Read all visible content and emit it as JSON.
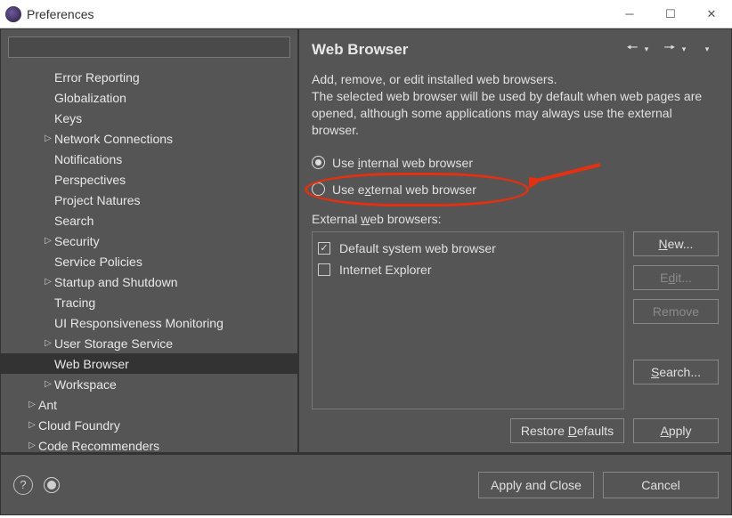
{
  "window": {
    "title": "Preferences"
  },
  "tree": [
    {
      "label": "Error Reporting",
      "level": 2,
      "expandable": false
    },
    {
      "label": "Globalization",
      "level": 2,
      "expandable": false
    },
    {
      "label": "Keys",
      "level": 2,
      "expandable": false
    },
    {
      "label": "Network Connections",
      "level": 2,
      "expandable": true
    },
    {
      "label": "Notifications",
      "level": 2,
      "expandable": false
    },
    {
      "label": "Perspectives",
      "level": 2,
      "expandable": false
    },
    {
      "label": "Project Natures",
      "level": 2,
      "expandable": false
    },
    {
      "label": "Search",
      "level": 2,
      "expandable": false
    },
    {
      "label": "Security",
      "level": 2,
      "expandable": true
    },
    {
      "label": "Service Policies",
      "level": 2,
      "expandable": false
    },
    {
      "label": "Startup and Shutdown",
      "level": 2,
      "expandable": true
    },
    {
      "label": "Tracing",
      "level": 2,
      "expandable": false
    },
    {
      "label": "UI Responsiveness Monitoring",
      "level": 2,
      "expandable": false
    },
    {
      "label": "User Storage Service",
      "level": 2,
      "expandable": true
    },
    {
      "label": "Web Browser",
      "level": 2,
      "expandable": false,
      "selected": true
    },
    {
      "label": "Workspace",
      "level": 2,
      "expandable": true
    },
    {
      "label": "Ant",
      "level": 1,
      "expandable": true
    },
    {
      "label": "Cloud Foundry",
      "level": 1,
      "expandable": true
    },
    {
      "label": "Code Recommenders",
      "level": 1,
      "expandable": true
    }
  ],
  "page": {
    "title": "Web Browser",
    "desc1": "Add, remove, or edit installed web browsers.",
    "desc2": "The selected web browser will be used by default when web pages are opened, although some applications may always use the external browser.",
    "radio_internal_pre": "Use ",
    "radio_internal_u": "i",
    "radio_internal_post": "nternal web browser",
    "radio_external_pre": "Use e",
    "radio_external_u": "x",
    "radio_external_post": "ternal web browser",
    "list_heading_pre": "External ",
    "list_heading_u": "w",
    "list_heading_post": "eb browsers:",
    "browsers": [
      {
        "label": "Default system web browser",
        "checked": true
      },
      {
        "label": "Internet Explorer",
        "checked": false
      }
    ],
    "buttons": {
      "new": "New...",
      "edit": "Edit...",
      "remove": "Remove",
      "search": "Search...",
      "restore": "Restore Defaults",
      "apply": "Apply",
      "applyclose": "Apply and Close",
      "cancel": "Cancel"
    }
  },
  "filter_placeholder": ""
}
